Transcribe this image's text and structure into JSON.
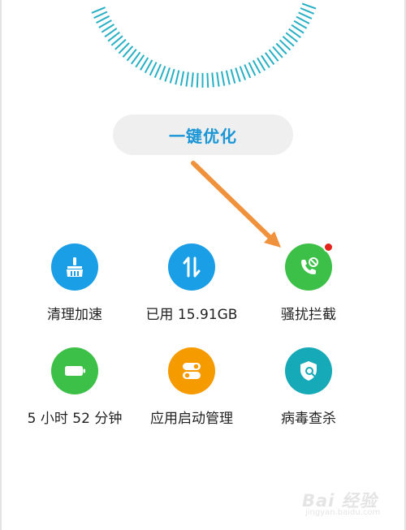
{
  "optimize_button": {
    "label": "一键优化"
  },
  "tiles": [
    {
      "label": "清理加速",
      "icon": "broom-icon",
      "color": "#1a9ee6"
    },
    {
      "label": "已用 15.91GB",
      "icon": "storage-arrows-icon",
      "color": "#1a9ee6"
    },
    {
      "label": "骚扰拦截",
      "icon": "blocked-call-icon",
      "color": "#3cc048",
      "badge": true
    },
    {
      "label": "5 小时 52 分钟",
      "icon": "battery-icon",
      "color": "#3cc048"
    },
    {
      "label": "应用启动管理",
      "icon": "toggle-switches-icon",
      "color": "#f59b00"
    },
    {
      "label": "病毒查杀",
      "icon": "shield-scan-icon",
      "color": "#16a9b8"
    }
  ],
  "colors": {
    "accent": "#1a96d6",
    "dial_ticks": "#27b0c4",
    "arrow": "#f0913c",
    "badge": "#e2231a"
  },
  "watermark": {
    "logo": "Bai 经验",
    "url": "jingyan.baidu.com"
  }
}
